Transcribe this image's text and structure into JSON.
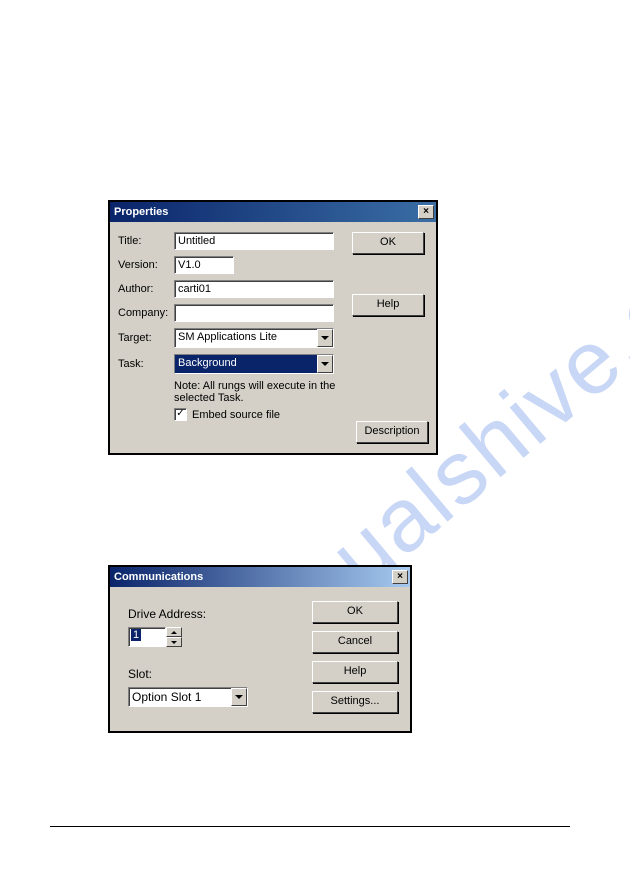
{
  "watermark": "manualshive.com",
  "properties_dialog": {
    "title": "Properties",
    "labels": {
      "title": "Title:",
      "version": "Version:",
      "author": "Author:",
      "company": "Company:",
      "target": "Target:",
      "task": "Task:"
    },
    "values": {
      "title": "Untitled",
      "version": "V1.0",
      "author": "carti01",
      "company": "",
      "target": "SM Applications Lite",
      "task": "Background"
    },
    "note": "Note: All rungs will execute in the selected Task.",
    "embed_label": "Embed source file",
    "embed_checked": true,
    "buttons": {
      "ok": "OK",
      "help": "Help",
      "description": "Description"
    }
  },
  "communications_dialog": {
    "title": "Communications",
    "labels": {
      "drive_address": "Drive Address:",
      "slot": "Slot:"
    },
    "values": {
      "drive_address": "1",
      "slot": "Option Slot 1"
    },
    "buttons": {
      "ok": "OK",
      "cancel": "Cancel",
      "help": "Help",
      "settings": "Settings..."
    }
  }
}
